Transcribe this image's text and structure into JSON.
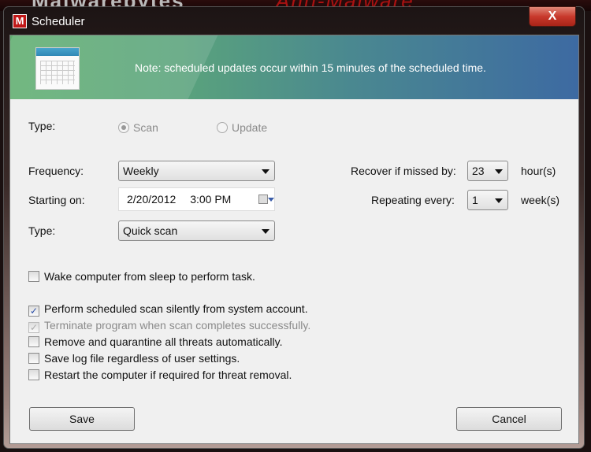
{
  "background": {
    "app_name": "Malwarebytes",
    "app_tagline": "Anti-Malware"
  },
  "window": {
    "title": "Scheduler",
    "icon": "malwarebytes-logo-icon",
    "icon_letter": "M",
    "close_label": "X"
  },
  "banner": {
    "icon": "calendar-icon",
    "note": "Note: scheduled updates occur within 15 minutes of the scheduled time.",
    "colors": {
      "left": "#5fae6f",
      "right": "#3d6aa2"
    }
  },
  "form": {
    "type_label": "Type:",
    "type_options": [
      {
        "label": "Scan",
        "selected": true,
        "enabled": false
      },
      {
        "label": "Update",
        "selected": false,
        "enabled": false
      }
    ],
    "frequency_label": "Frequency:",
    "frequency_value": "Weekly",
    "starting_label": "Starting on:",
    "starting_date": "2/20/2012",
    "starting_time": "3:00 PM",
    "scan_type_label": "Type:",
    "scan_type_value": "Quick scan",
    "recover_label": "Recover if missed by:",
    "recover_value": "23",
    "recover_unit": "hour(s)",
    "repeat_label": "Repeating every:",
    "repeat_value": "1",
    "repeat_unit": "week(s)"
  },
  "options": [
    {
      "label": "Wake computer from sleep to perform task.",
      "checked": false,
      "enabled": true
    },
    {
      "label": "Perform scheduled scan silently from system account.",
      "checked": true,
      "enabled": true
    },
    {
      "label": "Terminate program when scan completes successfully.",
      "checked": true,
      "enabled": false
    },
    {
      "label": "Remove and quarantine all threats automatically.",
      "checked": false,
      "enabled": true
    },
    {
      "label": "Save log file regardless of user settings.",
      "checked": false,
      "enabled": true
    },
    {
      "label": "Restart the computer if required for threat removal.",
      "checked": false,
      "enabled": true
    }
  ],
  "buttons": {
    "save": "Save",
    "cancel": "Cancel"
  }
}
